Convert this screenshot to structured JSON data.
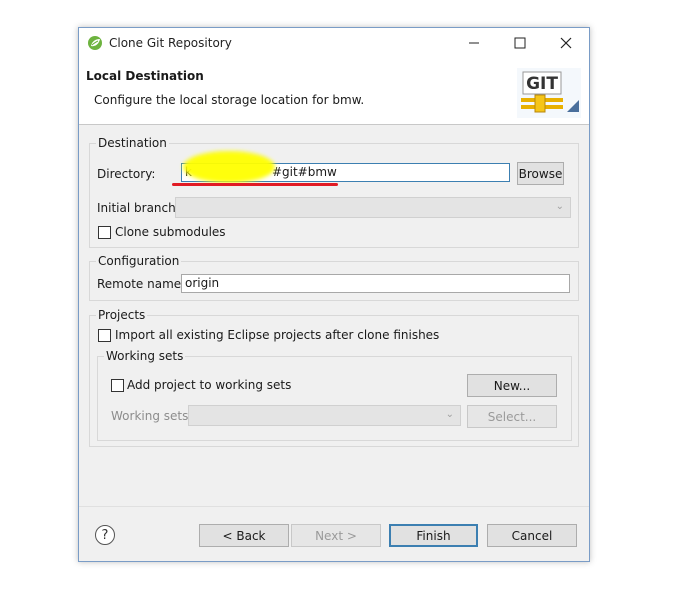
{
  "window": {
    "title": "Clone Git Repository",
    "controls": [
      "minimize",
      "maximize",
      "close"
    ]
  },
  "header": {
    "title": "Local Destination",
    "description": "Configure the local storage location for bmw.",
    "logo_text": "GIT"
  },
  "destination": {
    "legend": "Destination",
    "directory_label": "Directory:",
    "directory_value_prefix": "k",
    "directory_value_suffix": "#git#bmw",
    "browse_label": "Browse",
    "initial_branch_label": "Initial branch:",
    "initial_branch_value": "",
    "clone_submodules_label": "Clone submodules",
    "clone_submodules_checked": false
  },
  "configuration": {
    "legend": "Configuration",
    "remote_name_label": "Remote name:",
    "remote_name_value": "origin"
  },
  "projects": {
    "legend": "Projects",
    "import_label": "Import all existing Eclipse projects after clone finishes",
    "import_checked": false,
    "working_sets": {
      "legend": "Working sets",
      "add_label": "Add project to working sets",
      "add_checked": false,
      "new_button": "New...",
      "working_sets_label": "Working sets:",
      "working_sets_value": "",
      "select_button": "Select..."
    }
  },
  "footer": {
    "help_symbol": "?",
    "back_label": "< Back",
    "next_label": "Next >",
    "finish_label": "Finish",
    "cancel_label": "Cancel"
  },
  "annotations": {
    "highlight_color": "#ffff00",
    "underline_color": "#e11b24"
  }
}
